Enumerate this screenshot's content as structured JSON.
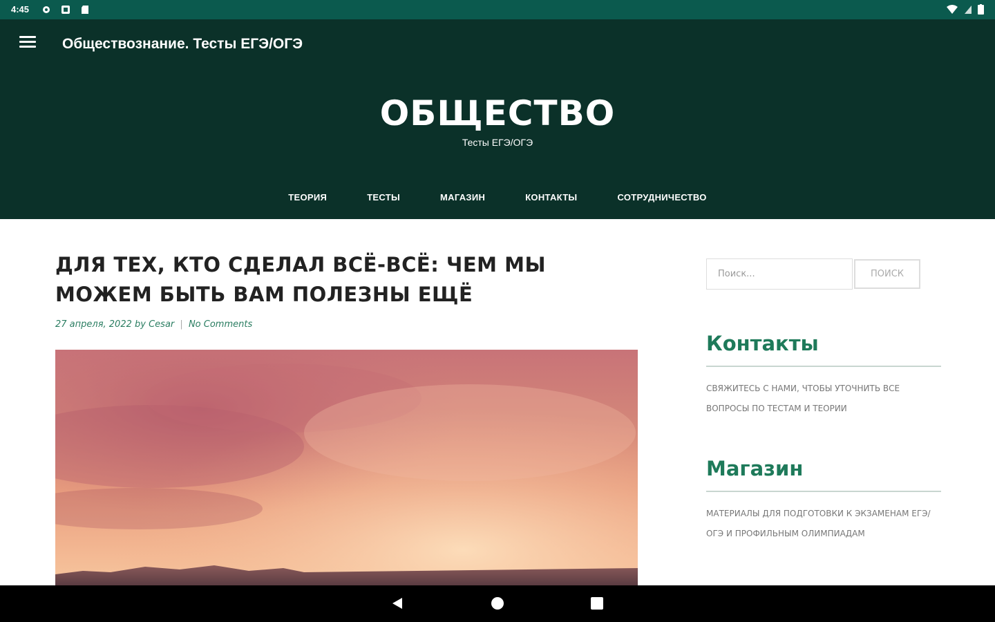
{
  "status_bar": {
    "time": "4:45",
    "icons_left": [
      "gear-icon",
      "notification-icon",
      "sd-card-icon"
    ],
    "icons_right": [
      "wifi-icon",
      "signal-icon",
      "battery-icon"
    ]
  },
  "app_bar": {
    "title": "Обществознание. Тесты ЕГЭ/ОГЭ",
    "menu_icon": "hamburger-menu-icon"
  },
  "site": {
    "title": "ОБЩЕСТВО",
    "tagline": "Тесты ЕГЭ/ОГЭ"
  },
  "nav": {
    "items": [
      {
        "label": "ТЕОРИЯ"
      },
      {
        "label": "ТЕСТЫ"
      },
      {
        "label": "МАГАЗИН"
      },
      {
        "label": "КОНТАКТЫ"
      },
      {
        "label": "СОТРУДНИЧЕСТВО"
      }
    ]
  },
  "post": {
    "title": "ДЛЯ ТЕХ, КТО СДЕЛАЛ ВСЁ-ВСЁ: ЧЕМ МЫ МОЖЕМ БЫТЬ ВАМ ПОЛЕЗНЫ ЕЩЁ",
    "date": "27 апреля, 2022",
    "by": "by",
    "author": "Cesar",
    "separator": "|",
    "comments": "No Comments"
  },
  "sidebar": {
    "search": {
      "placeholder": "Поиск...",
      "button_label": "ПОИСК"
    },
    "widgets": [
      {
        "title": "Контакты",
        "text": "Свяжитесь с нами, чтобы уточнить все вопросы по тестам и теории"
      },
      {
        "title": "Магазин",
        "text": "Материалы для подготовки к экзаменам ЕГЭ/ОГЭ и профильным олимпиадам"
      }
    ]
  },
  "system_nav": {
    "back": "back-icon",
    "home": "home-icon",
    "recents": "recents-icon"
  },
  "colors": {
    "status_bar": "#0b5a4e",
    "header": "#0b3129",
    "accent": "#1e7a5a"
  }
}
